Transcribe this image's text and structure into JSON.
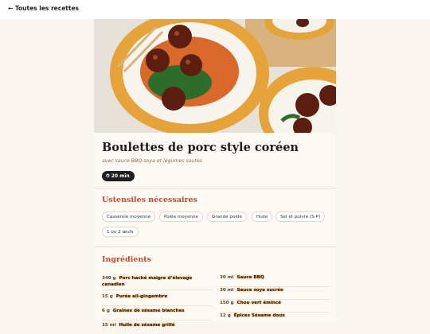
{
  "nav": {
    "back_label": "← Toutes les recettes"
  },
  "recipe": {
    "title": "Boulettes de porc style coréen",
    "subtitle": "avec sauce BBQ-soya et légumes sautés",
    "time_icon": "clock-icon",
    "time": "20 min"
  },
  "utensils": {
    "heading": "Ustensiles nécessaires",
    "items": [
      "Casserole moyenne",
      "Poêle moyenne",
      "Grande poêle",
      "Huile",
      "Sel et poivre (S-P)",
      "1 ou 2 œufs"
    ]
  },
  "ingredients": {
    "heading": "Ingrédients",
    "left": [
      {
        "qty": "340 g",
        "name": "Porc haché maigre d’élevage canadien"
      },
      {
        "qty": "15 g",
        "name": "Purée ail-gingembre"
      },
      {
        "qty": "6 g",
        "name": "Graines de sésame blanches"
      },
      {
        "qty": "15 ml",
        "name": "Huile de sésame grillé"
      }
    ],
    "right": [
      {
        "qty": "30 ml",
        "name": "Sauce BBQ"
      },
      {
        "qty": "30 ml",
        "name": "Sauce soya sucrée"
      },
      {
        "qty": "150 g",
        "name": "Chou vert émincé"
      },
      {
        "qty": "12 g",
        "name": "Épices Sésame doux"
      }
    ]
  }
}
